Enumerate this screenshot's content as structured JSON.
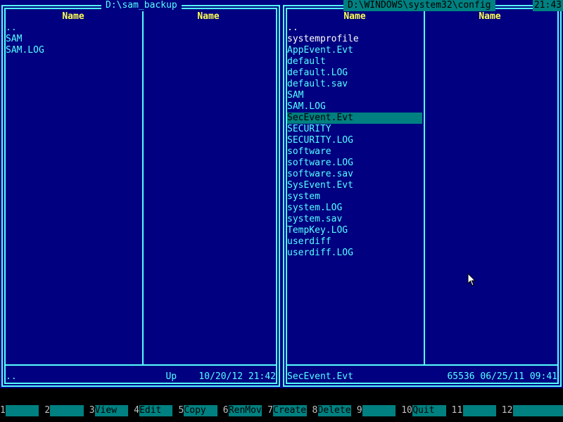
{
  "clock": "21:43",
  "left_panel": {
    "path": "D:\\sam_backup",
    "col_headers": [
      "Name",
      "Name"
    ],
    "files": [
      {
        "name": ".."
      },
      {
        "name": "SAM"
      },
      {
        "name": "SAM.LOG"
      }
    ],
    "status_left": "..",
    "status_right": "Up    10/20/12 21:42"
  },
  "right_panel": {
    "path": "D:\\WINDOWS\\system32\\config",
    "col_headers": [
      "Name",
      "Name"
    ],
    "files": [
      {
        "name": "..",
        "bright": true
      },
      {
        "name": "systemprofile",
        "bright": true
      },
      {
        "name": "AppEvent.Evt"
      },
      {
        "name": "default"
      },
      {
        "name": "default.LOG"
      },
      {
        "name": "default.sav"
      },
      {
        "name": "SAM"
      },
      {
        "name": "SAM.LOG"
      },
      {
        "name": "SecEvent.Evt",
        "selected": true
      },
      {
        "name": "SECURITY"
      },
      {
        "name": "SECURITY.LOG"
      },
      {
        "name": "software"
      },
      {
        "name": "software.LOG"
      },
      {
        "name": "software.sav"
      },
      {
        "name": "SysEvent.Evt"
      },
      {
        "name": "system"
      },
      {
        "name": "system.LOG"
      },
      {
        "name": "system.sav"
      },
      {
        "name": "TempKey.LOG"
      },
      {
        "name": "userdiff"
      },
      {
        "name": "userdiff.LOG"
      }
    ],
    "status_left": "SecEvent.Evt",
    "status_right": "65536 06/25/11 09:41"
  },
  "keybar": [
    {
      "num": "1",
      "label": ""
    },
    {
      "num": "2",
      "label": ""
    },
    {
      "num": "3",
      "label": "View"
    },
    {
      "num": "4",
      "label": "Edit"
    },
    {
      "num": "5",
      "label": "Copy"
    },
    {
      "num": "6",
      "label": "RenMov"
    },
    {
      "num": "7",
      "label": "Create"
    },
    {
      "num": "8",
      "label": "Delete"
    },
    {
      "num": "9",
      "label": ""
    },
    {
      "num": "10",
      "label": "Quit"
    },
    {
      "num": "11",
      "label": ""
    },
    {
      "num": "12",
      "label": ""
    }
  ],
  "colors": {
    "panel_bg": "#000080",
    "frame": "#55ffff",
    "header": "#ffff55",
    "selection": "#008080"
  }
}
